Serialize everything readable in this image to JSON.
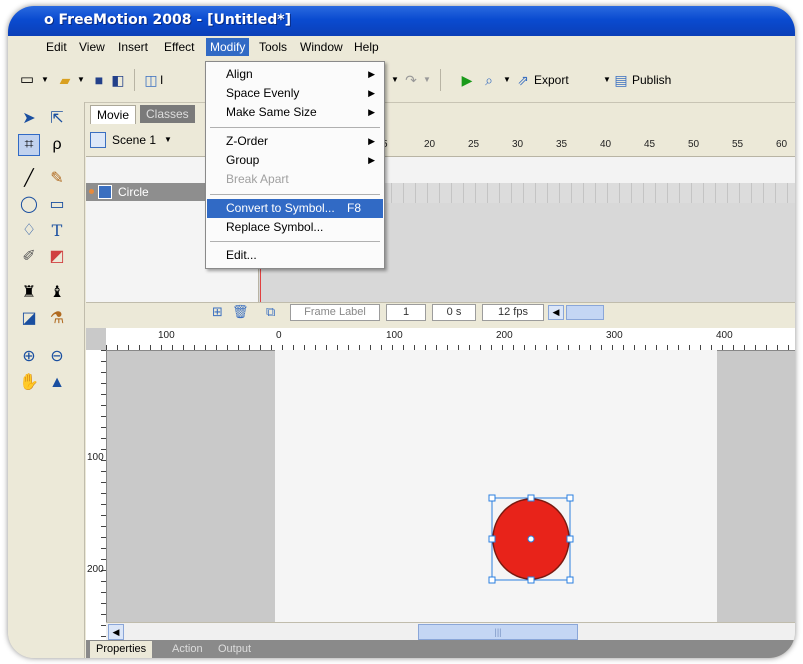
{
  "window": {
    "title": "o FreeMotion 2008 - [Untitled*]"
  },
  "menubar": {
    "items": [
      "Edit",
      "View",
      "Insert",
      "Effect",
      "Modify",
      "Tools",
      "Window",
      "Help"
    ],
    "active": "Modify"
  },
  "toolbar": {
    "import_fragment": "I",
    "export_label": "Export",
    "publish_label": "Publish"
  },
  "modify_menu": {
    "items": [
      {
        "label": "Align",
        "submenu": true
      },
      {
        "label": "Space Evenly",
        "submenu": true
      },
      {
        "label": "Make Same Size",
        "submenu": true
      },
      {
        "label": "Z-Order",
        "submenu": true
      },
      {
        "label": "Group",
        "submenu": true
      },
      {
        "label": "Break Apart",
        "disabled": true
      },
      {
        "label": "Convert to Symbol...",
        "shortcut": "F8",
        "highlighted": true
      },
      {
        "label": "Replace Symbol..."
      },
      {
        "label": "Edit..."
      }
    ]
  },
  "panel_tabs": [
    "Movie",
    "Classes"
  ],
  "scene": {
    "label": "Scene 1"
  },
  "timeline": {
    "layers": [
      {
        "name": "Circle"
      }
    ],
    "frame_ruler_labels": [
      "5",
      "20",
      "25",
      "30",
      "35",
      "40",
      "45",
      "50",
      "55",
      "60"
    ],
    "frame_label_placeholder": "Frame Label",
    "current_frame": "1",
    "time": "0 s",
    "fps": "12 fps"
  },
  "stage": {
    "hruler_labels": [
      "100",
      "0",
      "100",
      "200",
      "300",
      "400"
    ],
    "vruler_labels": [
      "100",
      "200"
    ],
    "shape": {
      "name": "Circle",
      "fill": "#e8231a",
      "stroke": "#7a1a10",
      "selection_color": "#2a7fe0"
    }
  },
  "bottom_tabs": [
    "Properties",
    "Action",
    "Output"
  ],
  "colors": {
    "title_bar": "#0a4bd0",
    "menu_highlight": "#316ac5",
    "chrome": "#ece9d8"
  }
}
